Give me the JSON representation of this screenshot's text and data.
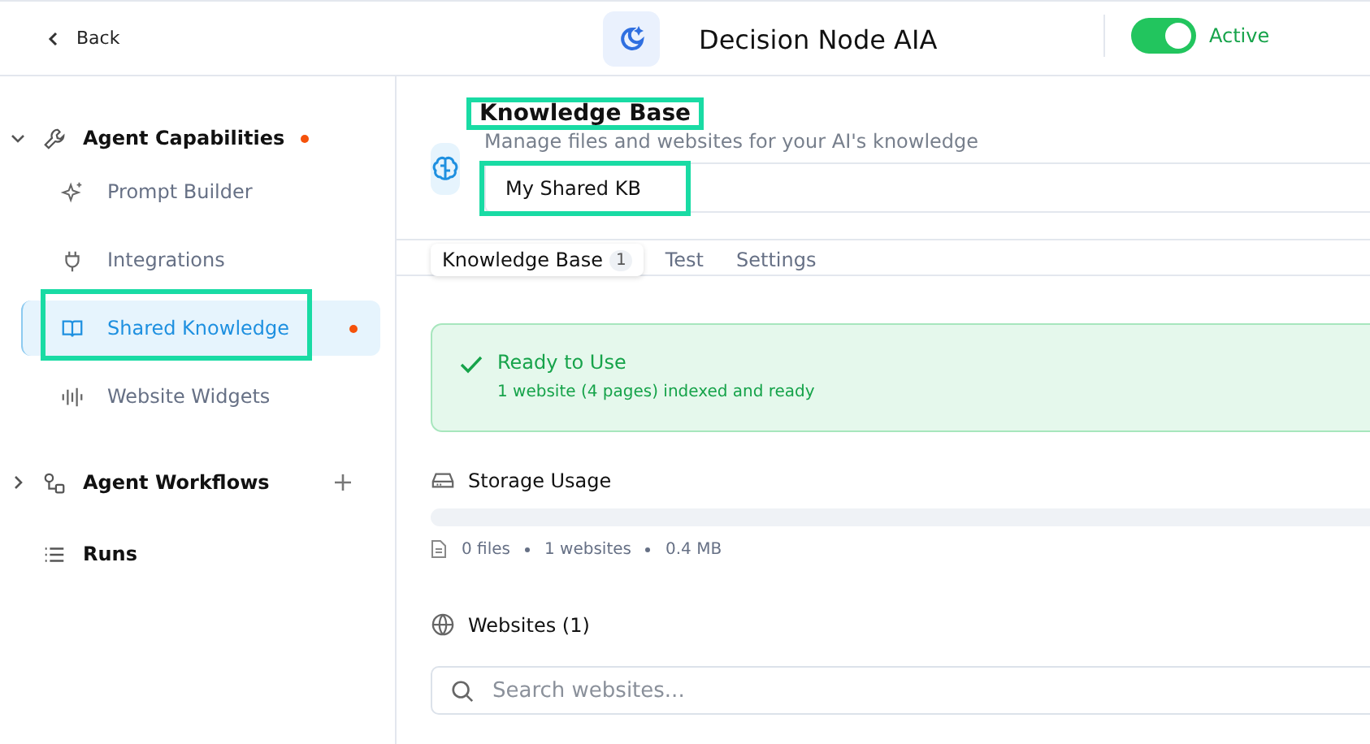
{
  "header": {
    "back": "Back",
    "title": "Decision Node AIA",
    "active": {
      "on": true,
      "label": "Active"
    }
  },
  "sidebar": {
    "groups": [
      {
        "label": "Agent Capabilities",
        "expanded": true,
        "dot": true,
        "add": false,
        "items": [
          {
            "label": "Prompt Builder",
            "selected": false,
            "dot": false,
            "highlighted": false
          },
          {
            "label": "Integrations",
            "selected": false,
            "dot": false,
            "highlighted": false
          },
          {
            "label": "Shared Knowledge",
            "selected": true,
            "dot": true,
            "highlighted": true
          },
          {
            "label": "Website Widgets",
            "selected": false,
            "dot": false,
            "highlighted": false
          }
        ]
      },
      {
        "label": "Agent Workflows",
        "expanded": false,
        "dot": false,
        "add": true
      },
      {
        "label": "Runs",
        "dot": false,
        "add": false
      }
    ]
  },
  "main": {
    "title": "Knowledge Base",
    "title_highlighted": true,
    "subtitle": "Manage files and websites for your AI's knowledge",
    "kb_name": {
      "value": "My Shared KB",
      "highlighted": true
    },
    "tabs": [
      {
        "label": "Knowledge Base",
        "badge": "1",
        "selected": true
      },
      {
        "label": "Test",
        "selected": false
      },
      {
        "label": "Settings",
        "selected": false
      }
    ],
    "status": {
      "title": "Ready to Use",
      "detail": "1 website (4 pages) indexed and ready"
    },
    "storage": {
      "title": "Storage Usage",
      "level": 0,
      "stats": [
        "0 files",
        "1 websites",
        "0.4 MB"
      ]
    },
    "websites": {
      "title": "Websites (1)",
      "search": {
        "placeholder": "Search websites..."
      }
    }
  }
}
